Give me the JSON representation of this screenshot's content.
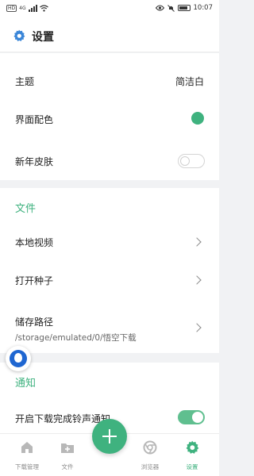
{
  "status_bar": {
    "carrier_badge": "HD",
    "network": "4G",
    "time": "10:07",
    "icons": [
      "sim-signal-icon",
      "wifi-icon",
      "eye-icon",
      "mute-icon",
      "battery-icon"
    ]
  },
  "header": {
    "title": "设置",
    "icon": "gear-icon"
  },
  "appearance": {
    "theme_label": "主题",
    "theme_value": "简洁白",
    "color_label": "界面配色",
    "color_value": "#3fb27f",
    "skin_label": "新年皮肤",
    "skin_enabled": false
  },
  "files_section": {
    "title": "文件",
    "local_video_label": "本地视频",
    "open_seed_label": "打开种子",
    "storage_label": "储存路径",
    "storage_path": "/storage/emulated/0/悟空下载"
  },
  "notify_section": {
    "title": "通知",
    "download_complete_label": "开启下载完成铃声通知",
    "download_complete_enabled": true
  },
  "bottom_nav": {
    "items": [
      {
        "label": "下载管理",
        "icon": "home-icon"
      },
      {
        "label": "文件",
        "icon": "folder-add-icon"
      },
      {
        "label": "浏览器",
        "icon": "browser-icon"
      },
      {
        "label": "设置",
        "icon": "gear-icon"
      }
    ],
    "active": "设置",
    "fab_icon": "plus-icon"
  },
  "colors": {
    "accent": "#3fb27f",
    "background": "#f1f2f4"
  }
}
